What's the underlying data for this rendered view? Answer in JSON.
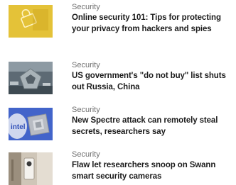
{
  "stories": [
    {
      "thumbnail": "yellow-security-lock-image",
      "category": "Security",
      "headline": "Online security 101: Tips for protecting your privacy from hackers and spies"
    },
    {
      "thumbnail": "pentagon-aerial-image",
      "category": "Security",
      "headline": "US government's \"do not buy\" list shuts out Russia, China"
    },
    {
      "thumbnail": "intel-processor-chip-image",
      "category": "Security",
      "headline": "New Spectre attack can remotely steal secrets, researchers say"
    },
    {
      "thumbnail": "smart-security-camera-image",
      "category": "Security",
      "headline": "Flaw let researchers snoop on Swann smart security cameras"
    }
  ]
}
